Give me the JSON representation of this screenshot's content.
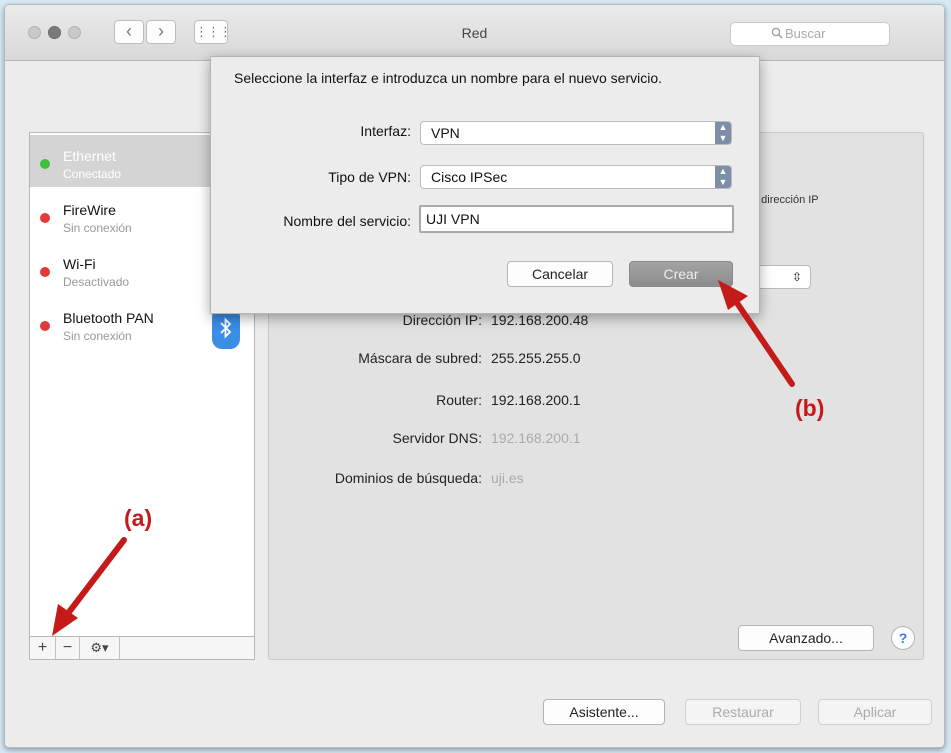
{
  "window": {
    "title": "Red"
  },
  "toolbar": {
    "back": "‹",
    "forward": "›",
    "grid": "⋮⋮⋮",
    "search_placeholder": "Buscar"
  },
  "sidebar": {
    "services": [
      {
        "name": "Ethernet",
        "status": "Conectado",
        "status_color": "#3cc13c"
      },
      {
        "name": "FireWire",
        "status": "Sin conexión",
        "status_color": "#e03a3a"
      },
      {
        "name": "Wi-Fi",
        "status": "Desactivado",
        "status_color": "#e03a3a"
      },
      {
        "name": "Bluetooth PAN",
        "status": "Sin conexión",
        "status_color": "#e03a3a"
      }
    ],
    "tools": {
      "add": "+",
      "remove": "−",
      "gear": "⚙▾"
    }
  },
  "detail": {
    "note_fragment": "a dirección IP",
    "ip_label": "Dirección IP:",
    "ip_value": "192.168.200.48",
    "mask_label": "Máscara de subred:",
    "mask_value": "255.255.255.0",
    "router_label": "Router:",
    "router_value": "192.168.200.1",
    "dns_label": "Servidor DNS:",
    "dns_value": "192.168.200.1",
    "domains_label": "Dominios de búsqueda:",
    "domains_value": "uji.es",
    "advanced_button": "Avanzado...",
    "help_button": "?"
  },
  "footer": {
    "assistant_button": "Asistente...",
    "revert_button": "Restaurar",
    "apply_button": "Aplicar"
  },
  "sheet": {
    "message": "Seleccione la interfaz e introduzca un nombre para el nuevo servicio.",
    "interface_label": "Interfaz:",
    "interface_value": "VPN",
    "vpn_type_label": "Tipo de VPN:",
    "vpn_type_value": "Cisco IPSec",
    "service_name_label": "Nombre del servicio:",
    "service_name_value": "UJI VPN",
    "cancel_button": "Cancelar",
    "create_button": "Crear"
  },
  "annotations": {
    "a": "(a)",
    "b": "(b)",
    "color": "#c41a1a"
  },
  "colors": {
    "accent_blue": "#3a8ee6",
    "connected": "#3cc13c",
    "disconnected": "#e03a3a"
  }
}
